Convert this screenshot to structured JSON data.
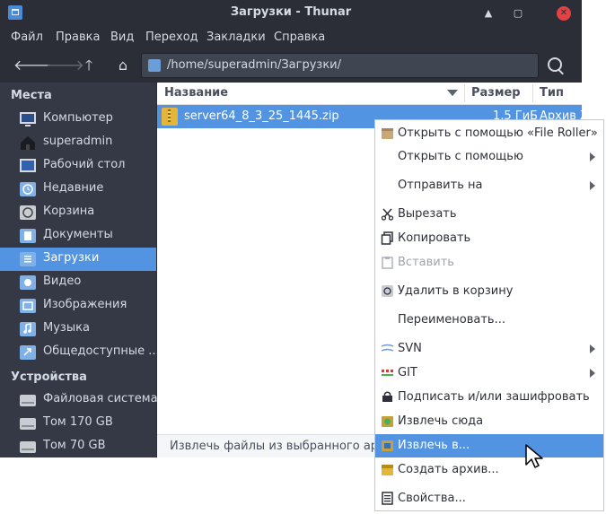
{
  "window": {
    "title": "Загрузки - Thunar"
  },
  "menubar": [
    "Файл",
    "Правка",
    "Вид",
    "Переход",
    "Закладки",
    "Справка"
  ],
  "toolbar": {
    "path": "/home/superadmin/Загрузки/"
  },
  "sidebar": {
    "places_header": "Места",
    "places": [
      {
        "label": "Компьютер",
        "icon": "computer-icon"
      },
      {
        "label": "superadmin",
        "icon": "home-icon"
      },
      {
        "label": "Рабочий стол",
        "icon": "desktop-icon"
      },
      {
        "label": "Недавние",
        "icon": "recent-icon"
      },
      {
        "label": "Корзина",
        "icon": "trash-icon"
      },
      {
        "label": "Документы",
        "icon": "documents-folder-icon"
      },
      {
        "label": "Загрузки",
        "icon": "downloads-folder-icon",
        "selected": true
      },
      {
        "label": "Видео",
        "icon": "videos-folder-icon"
      },
      {
        "label": "Изображения",
        "icon": "pictures-folder-icon"
      },
      {
        "label": "Музыка",
        "icon": "music-folder-icon"
      },
      {
        "label": "Общедоступные ...",
        "icon": "public-folder-icon"
      }
    ],
    "devices_header": "Устройства",
    "devices": [
      {
        "label": "Файловая система",
        "icon": "drive-icon"
      },
      {
        "label": "Том 170 GB",
        "icon": "drive-icon"
      },
      {
        "label": "Том 70 GB",
        "icon": "drive-icon"
      }
    ]
  },
  "filelist": {
    "columns": {
      "name": "Название",
      "size": "Размер",
      "type": "Тип"
    },
    "rows": [
      {
        "name": "server64_8_3_25_1445.zip",
        "size": "1,5 ГиБ",
        "type": "Архив Z"
      }
    ]
  },
  "statusbar": {
    "text": "Извлечь файлы из выбранного архив"
  },
  "context_menu": {
    "items": [
      {
        "label": "Открыть с помощью «File Roller»",
        "icon": "archive-manager-icon"
      },
      {
        "label": "Открыть с помощью",
        "submenu": true
      },
      {
        "label": "Отправить на",
        "submenu": true
      },
      {
        "label": "Вырезать",
        "icon": "cut-icon"
      },
      {
        "label": "Копировать",
        "icon": "copy-icon"
      },
      {
        "label": "Вставить",
        "icon": "paste-icon",
        "disabled": true
      },
      {
        "label": "Удалить в корзину",
        "icon": "trash-icon"
      },
      {
        "label": "Переименовать..."
      },
      {
        "label": "SVN",
        "icon": "svn-icon",
        "submenu": true
      },
      {
        "label": "GIT",
        "icon": "git-icon",
        "submenu": true
      },
      {
        "label": "Подписать и/или зашифровать",
        "icon": "encrypt-icon"
      },
      {
        "label": "Извлечь сюда",
        "icon": "extract-here-icon"
      },
      {
        "label": "Извлечь в...",
        "icon": "extract-to-icon",
        "hover": true
      },
      {
        "label": "Создать архив...",
        "icon": "create-archive-icon"
      },
      {
        "label": "Свойства...",
        "icon": "properties-icon"
      }
    ]
  },
  "colors": {
    "accent": "#5294e2",
    "sidebar_bg": "#353945",
    "window_bg": "#2b2e37"
  }
}
